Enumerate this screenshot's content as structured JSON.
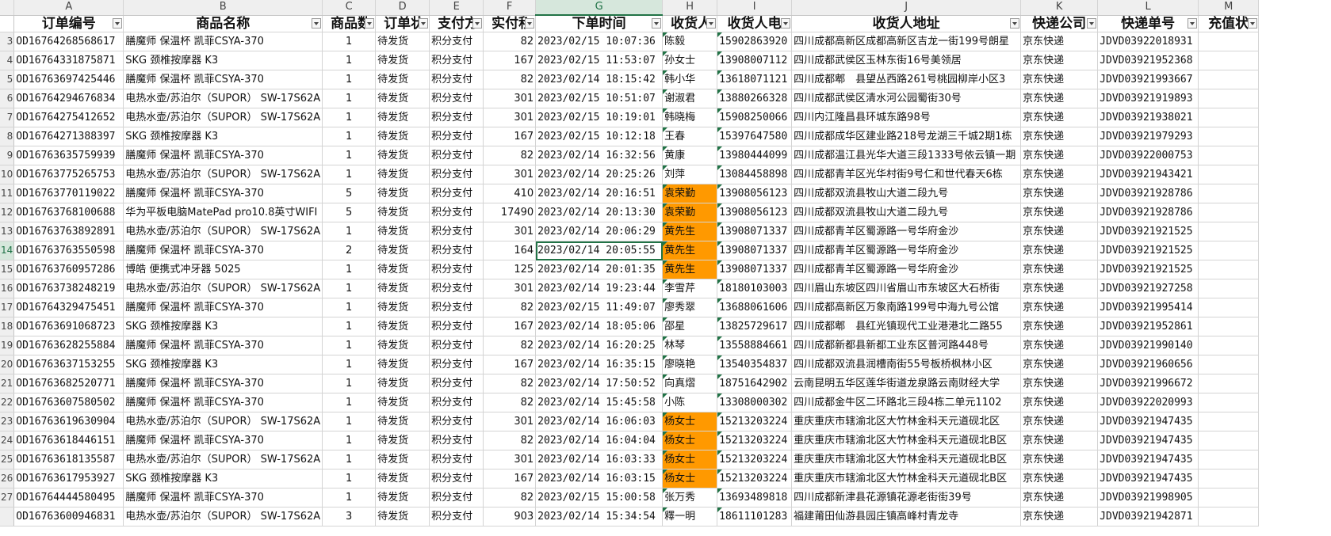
{
  "sheet": {
    "columns": [
      "A",
      "B",
      "C",
      "D",
      "E",
      "F",
      "G",
      "H",
      "I",
      "J",
      "K",
      "L",
      "M"
    ],
    "selected_column": "G",
    "highlight_color": "#ff9900",
    "headers": [
      "订单编号",
      "商品名称",
      "商品数",
      "订单状",
      "支付方",
      "实付积",
      "下单时间",
      "收货人",
      "收货人电",
      "收货人地址",
      "快递公司",
      "快递单号",
      "充值状"
    ],
    "row_labels": [
      "",
      "3",
      "4",
      "5",
      "6",
      "7",
      "8",
      "9",
      "10",
      "11",
      "12",
      "13",
      "14",
      "15",
      "16",
      "17",
      "18",
      "19",
      "20",
      "21",
      "22",
      "23",
      "24",
      "25",
      "26",
      "27"
    ],
    "rows": [
      {
        "id": "OD16764268568617",
        "product": "膳魔师 保温杯 凯菲CSYA-370",
        "qty": "1",
        "status": "待发货",
        "pay": "积分支付",
        "amount": "82",
        "time": "2023/02/15 10:07:36",
        "name": "陈毅",
        "phone": "15902863920",
        "address": "四川成都高新区成都高新区吉龙一街199号朗星",
        "courier": "京东快递",
        "tracking": "JDVD03922018931",
        "hl": false
      },
      {
        "id": "OD16764331875871",
        "product": "SKG 颈椎按摩器 K3",
        "qty": "1",
        "status": "待发货",
        "pay": "积分支付",
        "amount": "167",
        "time": "2023/02/15 11:53:07",
        "name": "孙女士",
        "phone": "13908007112",
        "address": "四川成都武侯区玉林东街16号美领居",
        "courier": "京东快递",
        "tracking": "JDVD03921952368",
        "hl": false
      },
      {
        "id": "OD16763697425446",
        "product": "膳魔师 保温杯 凯菲CSYA-370",
        "qty": "1",
        "status": "待发货",
        "pay": "积分支付",
        "amount": "82",
        "time": "2023/02/14 18:15:42",
        "name": "韩小华",
        "phone": "13618071121",
        "address": "四川成都郫　县望丛西路261号桃园柳岸小区3",
        "courier": "京东快递",
        "tracking": "JDVD03921993667",
        "hl": false
      },
      {
        "id": "OD16764294676834",
        "product": "电热水壶/苏泊尔（SUPOR） SW-17S62A",
        "qty": "1",
        "status": "待发货",
        "pay": "积分支付",
        "amount": "301",
        "time": "2023/02/15 10:51:07",
        "name": "谢淑君",
        "phone": "13880266328",
        "address": "四川成都武侯区清水河公园蜀街30号",
        "courier": "京东快递",
        "tracking": "JDVD03921919893",
        "hl": false
      },
      {
        "id": "OD16764275412652",
        "product": "电热水壶/苏泊尔（SUPOR） SW-17S62A",
        "qty": "1",
        "status": "待发货",
        "pay": "积分支付",
        "amount": "301",
        "time": "2023/02/15 10:19:01",
        "name": "韩晓梅",
        "phone": "15908250066",
        "address": "四川内江隆昌县环城东路98号",
        "courier": "京东快递",
        "tracking": "JDVD03921938021",
        "hl": false
      },
      {
        "id": "OD16764271388397",
        "product": "SKG 颈椎按摩器 K3",
        "qty": "1",
        "status": "待发货",
        "pay": "积分支付",
        "amount": "167",
        "time": "2023/02/15 10:12:18",
        "name": "王春",
        "phone": "15397647580",
        "address": "四川成都成华区建业路218号龙湖三千城2期1栋",
        "courier": "京东快递",
        "tracking": "JDVD03921979293",
        "hl": false
      },
      {
        "id": "OD16763635759939",
        "product": "膳魔师 保温杯 凯菲CSYA-370",
        "qty": "1",
        "status": "待发货",
        "pay": "积分支付",
        "amount": "82",
        "time": "2023/02/14 16:32:56",
        "name": "黄康",
        "phone": "13980444099",
        "address": "四川成都温江县光华大道三段1333号依云镇一期",
        "courier": "京东快递",
        "tracking": "JDVD03922000753",
        "hl": false
      },
      {
        "id": "OD16763775265753",
        "product": "电热水壶/苏泊尔（SUPOR） SW-17S62A",
        "qty": "1",
        "status": "待发货",
        "pay": "积分支付",
        "amount": "301",
        "time": "2023/02/14 20:25:26",
        "name": "刘萍",
        "phone": "13084458898",
        "address": "四川成都青羊区光华村街9号仁和世代春天6栋",
        "courier": "京东快递",
        "tracking": "JDVD03921943421",
        "hl": false
      },
      {
        "id": "OD16763770119022",
        "product": "膳魔师 保温杯 凯菲CSYA-370",
        "qty": "5",
        "status": "待发货",
        "pay": "积分支付",
        "amount": "410",
        "time": "2023/02/14 20:16:51",
        "name": "袁荣勤",
        "phone": "13908056123",
        "address": "四川成都双流县牧山大道二段九号",
        "courier": "京东快递",
        "tracking": "JDVD03921928786",
        "hl": true
      },
      {
        "id": "OD16763768100688",
        "product": "华为平板电脑MatePad pro10.8英寸WIFI",
        "qty": "5",
        "status": "待发货",
        "pay": "积分支付",
        "amount": "17490",
        "time": "2023/02/14 20:13:30",
        "name": "袁荣勤",
        "phone": "13908056123",
        "address": "四川成都双流县牧山大道二段九号",
        "courier": "京东快递",
        "tracking": "JDVD03921928786",
        "hl": true
      },
      {
        "id": "OD16763763892891",
        "product": "电热水壶/苏泊尔（SUPOR） SW-17S62A",
        "qty": "1",
        "status": "待发货",
        "pay": "积分支付",
        "amount": "301",
        "time": "2023/02/14 20:06:29",
        "name": "黄先生",
        "phone": "13908071337",
        "address": "四川成都青羊区蜀源路一号华府金沙",
        "courier": "京东快递",
        "tracking": "JDVD03921921525",
        "hl": true
      },
      {
        "id": "OD16763763550598",
        "product": "膳魔师 保温杯 凯菲CSYA-370",
        "qty": "2",
        "status": "待发货",
        "pay": "积分支付",
        "amount": "164",
        "time": "2023/02/14 20:05:55",
        "name": "黄先生",
        "phone": "13908071337",
        "address": "四川成都青羊区蜀源路一号华府金沙",
        "courier": "京东快递",
        "tracking": "JDVD03921921525",
        "hl": true,
        "active": true
      },
      {
        "id": "OD16763760957286",
        "product": "博皓 便携式冲牙器 5025",
        "qty": "1",
        "status": "待发货",
        "pay": "积分支付",
        "amount": "125",
        "time": "2023/02/14 20:01:35",
        "name": "黄先生",
        "phone": "13908071337",
        "address": "四川成都青羊区蜀源路一号华府金沙",
        "courier": "京东快递",
        "tracking": "JDVD03921921525",
        "hl": true
      },
      {
        "id": "OD16763738248219",
        "product": "电热水壶/苏泊尔（SUPOR） SW-17S62A",
        "qty": "1",
        "status": "待发货",
        "pay": "积分支付",
        "amount": "301",
        "time": "2023/02/14 19:23:44",
        "name": "李雪芹",
        "phone": "18180103003",
        "address": "四川眉山东坡区四川省眉山市东坡区大石桥街",
        "courier": "京东快递",
        "tracking": "JDVD03921927258",
        "hl": false
      },
      {
        "id": "OD16764329475451",
        "product": "膳魔师 保温杯 凯菲CSYA-370",
        "qty": "1",
        "status": "待发货",
        "pay": "积分支付",
        "amount": "82",
        "time": "2023/02/15 11:49:07",
        "name": "廖秀翠",
        "phone": "13688061606",
        "address": "四川成都高新区万象南路199号中海九号公馆",
        "courier": "京东快递",
        "tracking": "JDVD03921995414",
        "hl": false
      },
      {
        "id": "OD16763691068723",
        "product": "SKG 颈椎按摩器 K3",
        "qty": "1",
        "status": "待发货",
        "pay": "积分支付",
        "amount": "167",
        "time": "2023/02/14 18:05:06",
        "name": "邵星",
        "phone": "13825729617",
        "address": "四川成都郫　县红光镇现代工业港港北二路55",
        "courier": "京东快递",
        "tracking": "JDVD03921952861",
        "hl": false
      },
      {
        "id": "OD16763628255884",
        "product": "膳魔师 保温杯 凯菲CSYA-370",
        "qty": "1",
        "status": "待发货",
        "pay": "积分支付",
        "amount": "82",
        "time": "2023/02/14 16:20:25",
        "name": "林琴",
        "phone": "13558884661",
        "address": "四川成都新都县新都工业东区普河路448号",
        "courier": "京东快递",
        "tracking": "JDVD03921990140",
        "hl": false
      },
      {
        "id": "OD16763637153255",
        "product": "SKG 颈椎按摩器 K3",
        "qty": "1",
        "status": "待发货",
        "pay": "积分支付",
        "amount": "167",
        "time": "2023/02/14 16:35:15",
        "name": "廖晓艳",
        "phone": "13540354837",
        "address": "四川成都双流县润槽南街55号板桥枫林小区",
        "courier": "京东快递",
        "tracking": "JDVD03921960656",
        "hl": false
      },
      {
        "id": "OD16763682520771",
        "product": "膳魔师 保温杯 凯菲CSYA-370",
        "qty": "1",
        "status": "待发货",
        "pay": "积分支付",
        "amount": "82",
        "time": "2023/02/14 17:50:52",
        "name": "向真熠",
        "phone": "18751642902",
        "address": "云南昆明五华区莲华街道龙泉路云南财经大学",
        "courier": "京东快递",
        "tracking": "JDVD03921996672",
        "hl": false
      },
      {
        "id": "OD16763607580502",
        "product": "膳魔师 保温杯 凯菲CSYA-370",
        "qty": "1",
        "status": "待发货",
        "pay": "积分支付",
        "amount": "82",
        "time": "2023/02/14 15:45:58",
        "name": "小陈",
        "phone": "13308000302",
        "address": "四川成都金牛区二环路北三段4栋二单元1102",
        "courier": "京东快递",
        "tracking": "JDVD03922020993",
        "hl": false
      },
      {
        "id": "OD16763619630904",
        "product": "电热水壶/苏泊尔（SUPOR） SW-17S62A",
        "qty": "1",
        "status": "待发货",
        "pay": "积分支付",
        "amount": "301",
        "time": "2023/02/14 16:06:03",
        "name": "杨女士",
        "phone": "15213203224",
        "address": "重庆重庆市辖渝北区大竹林金科天元道砚北区",
        "courier": "京东快递",
        "tracking": "JDVD03921947435",
        "hl": true
      },
      {
        "id": "OD16763618446151",
        "product": "膳魔师 保温杯 凯菲CSYA-370",
        "qty": "1",
        "status": "待发货",
        "pay": "积分支付",
        "amount": "82",
        "time": "2023/02/14 16:04:04",
        "name": "杨女士",
        "phone": "15213203224",
        "address": "重庆重庆市辖渝北区大竹林金科天元道砚北B区",
        "courier": "京东快递",
        "tracking": "JDVD03921947435",
        "hl": true
      },
      {
        "id": "OD16763618135587",
        "product": "电热水壶/苏泊尔（SUPOR） SW-17S62A",
        "qty": "1",
        "status": "待发货",
        "pay": "积分支付",
        "amount": "301",
        "time": "2023/02/14 16:03:33",
        "name": "杨女士",
        "phone": "15213203224",
        "address": "重庆重庆市辖渝北区大竹林金科天元道砚北B区",
        "courier": "京东快递",
        "tracking": "JDVD03921947435",
        "hl": true
      },
      {
        "id": "OD16763617953927",
        "product": "SKG 颈椎按摩器 K3",
        "qty": "1",
        "status": "待发货",
        "pay": "积分支付",
        "amount": "167",
        "time": "2023/02/14 16:03:15",
        "name": "杨女士",
        "phone": "15213203224",
        "address": "重庆重庆市辖渝北区大竹林金科天元道砚北B区",
        "courier": "京东快递",
        "tracking": "JDVD03921947435",
        "hl": true
      },
      {
        "id": "OD16764444580495",
        "product": "膳魔师 保温杯 凯菲CSYA-370",
        "qty": "1",
        "status": "待发货",
        "pay": "积分支付",
        "amount": "82",
        "time": "2023/02/15 15:00:58",
        "name": "张万秀",
        "phone": "13693489818",
        "address": "四川成都新津县花源镇花源老街街39号",
        "courier": "京东快递",
        "tracking": "JDVD03921998905",
        "hl": false
      },
      {
        "id": "OD16763600946831",
        "product": "电热水壶/苏泊尔（SUPOR） SW-17S62A",
        "qty": "3",
        "status": "待发货",
        "pay": "积分支付",
        "amount": "903",
        "time": "2023/02/14 15:34:54",
        "name": "釋一明",
        "phone": "18611101283",
        "address": "福建莆田仙游县园庄镇高峰村青龙寺",
        "courier": "京东快递",
        "tracking": "JDVD03921942871",
        "hl": false
      }
    ]
  }
}
